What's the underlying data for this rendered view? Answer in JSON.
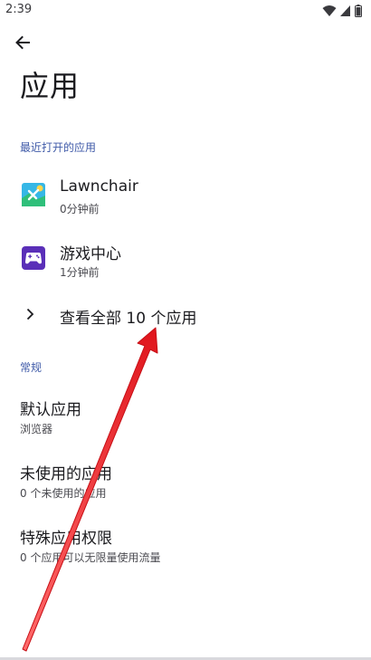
{
  "status_bar": {
    "time": "2:39",
    "icons": [
      "wifi-icon",
      "signal-icon",
      "battery-icon"
    ]
  },
  "header": {
    "back_icon": "back-arrow-icon",
    "title": "应用"
  },
  "recent": {
    "header": "最近打开的应用",
    "apps": [
      {
        "name": "Lawnchair",
        "sub": "0分钟前",
        "icon": "lawnchair-app-icon"
      },
      {
        "name": "游戏中心",
        "sub": "1分钟前",
        "icon": "game-center-app-icon"
      }
    ],
    "see_all": "查看全部 10 个应用"
  },
  "general": {
    "header": "常规",
    "items": [
      {
        "title": "默认应用",
        "sub": "浏览器"
      },
      {
        "title": "未使用的应用",
        "sub": "0 个未使用的应用"
      },
      {
        "title": "特殊应用权限",
        "sub": "0 个应用可以无限量使用流量"
      }
    ]
  },
  "colors": {
    "accent": "#3f5aa8",
    "annotation_arrow": "#e8242a",
    "background": "#ffffff"
  }
}
